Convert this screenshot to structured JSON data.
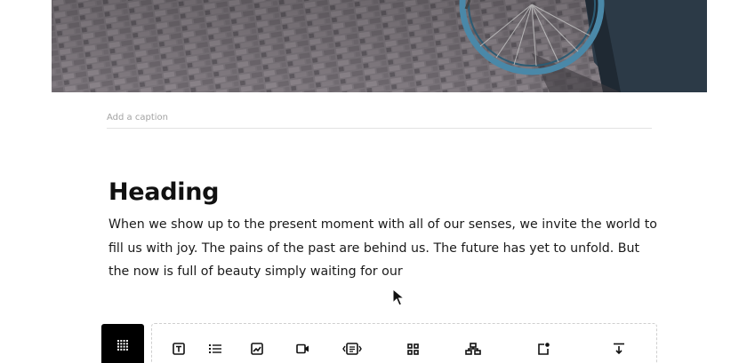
{
  "editor": {
    "image_block": {
      "description_icon": "photo-bicycle-wheel-on-brick-pavement"
    },
    "caption": {
      "placeholder": "Add a caption",
      "value": ""
    },
    "heading": "Heading",
    "paragraph": "When we show up to the present moment with all of our senses, we invite the world to fill us with joy. The pains of the past are behind us. The future has yet to unfold. But the now is full of beauty simply waiting for our"
  },
  "inserter": {
    "add_button_icon": "grid-dots-icon",
    "tools": [
      {
        "icon": "text-block-icon"
      },
      {
        "icon": "list-icon"
      },
      {
        "icon": "image-icon"
      },
      {
        "icon": "video-icon"
      },
      {
        "icon": "media-text-icon"
      },
      {
        "icon": "gallery-grid-icon"
      },
      {
        "icon": "sitemap-icon"
      },
      {
        "icon": "notification-box-icon"
      },
      {
        "icon": "insert-below-icon"
      }
    ]
  },
  "colors": {
    "text": "#111111",
    "caption_placeholder": "#a3a3a3",
    "divider": "#e2e2e2",
    "add_button_bg": "#000000",
    "wheel_rim": "#4a88a8"
  }
}
